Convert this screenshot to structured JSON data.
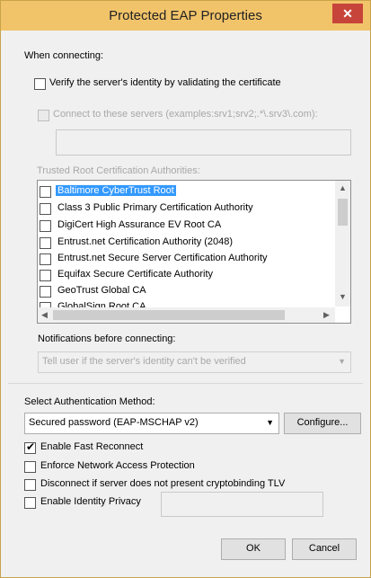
{
  "window": {
    "title": "Protected EAP Properties",
    "close_glyph": "✕"
  },
  "when_connecting": "When connecting:",
  "verify_cert": {
    "label": "Verify the server's identity by validating the certificate",
    "checked": false
  },
  "connect_servers": {
    "label": "Connect to these servers (examples:srv1;srv2;.*\\.srv3\\.com):",
    "checked": false
  },
  "trusted_root_label": "Trusted Root Certification Authorities:",
  "certificates": [
    {
      "name": "Baltimore CyberTrust Root",
      "selected": true
    },
    {
      "name": "Class 3 Public Primary Certification Authority",
      "selected": false
    },
    {
      "name": "DigiCert High Assurance EV Root CA",
      "selected": false
    },
    {
      "name": "Entrust.net Certification Authority (2048)",
      "selected": false
    },
    {
      "name": "Entrust.net Secure Server Certification Authority",
      "selected": false
    },
    {
      "name": "Equifax Secure Certificate Authority",
      "selected": false
    },
    {
      "name": "GeoTrust Global CA",
      "selected": false
    },
    {
      "name": "GlobalSign Root CA",
      "selected": false
    }
  ],
  "scroll": {
    "up": "▲",
    "down": "▼",
    "left": "◀",
    "right": "▶"
  },
  "notifications": {
    "label": "Notifications before connecting:",
    "value": "Tell user if the server's identity can't be verified",
    "arrow": "▼"
  },
  "auth_method": {
    "label": "Select Authentication Method:",
    "value": "Secured password (EAP-MSCHAP v2)",
    "arrow": "▼",
    "configure_label": "Configure..."
  },
  "options": [
    {
      "label": "Enable Fast Reconnect",
      "checked": true
    },
    {
      "label": "Enforce Network Access Protection",
      "checked": false
    },
    {
      "label": "Disconnect if server does not present cryptobinding TLV",
      "checked": false
    },
    {
      "label": "Enable Identity Privacy",
      "checked": false
    }
  ],
  "check_glyph": "✔",
  "buttons": {
    "ok": "OK",
    "cancel": "Cancel"
  }
}
